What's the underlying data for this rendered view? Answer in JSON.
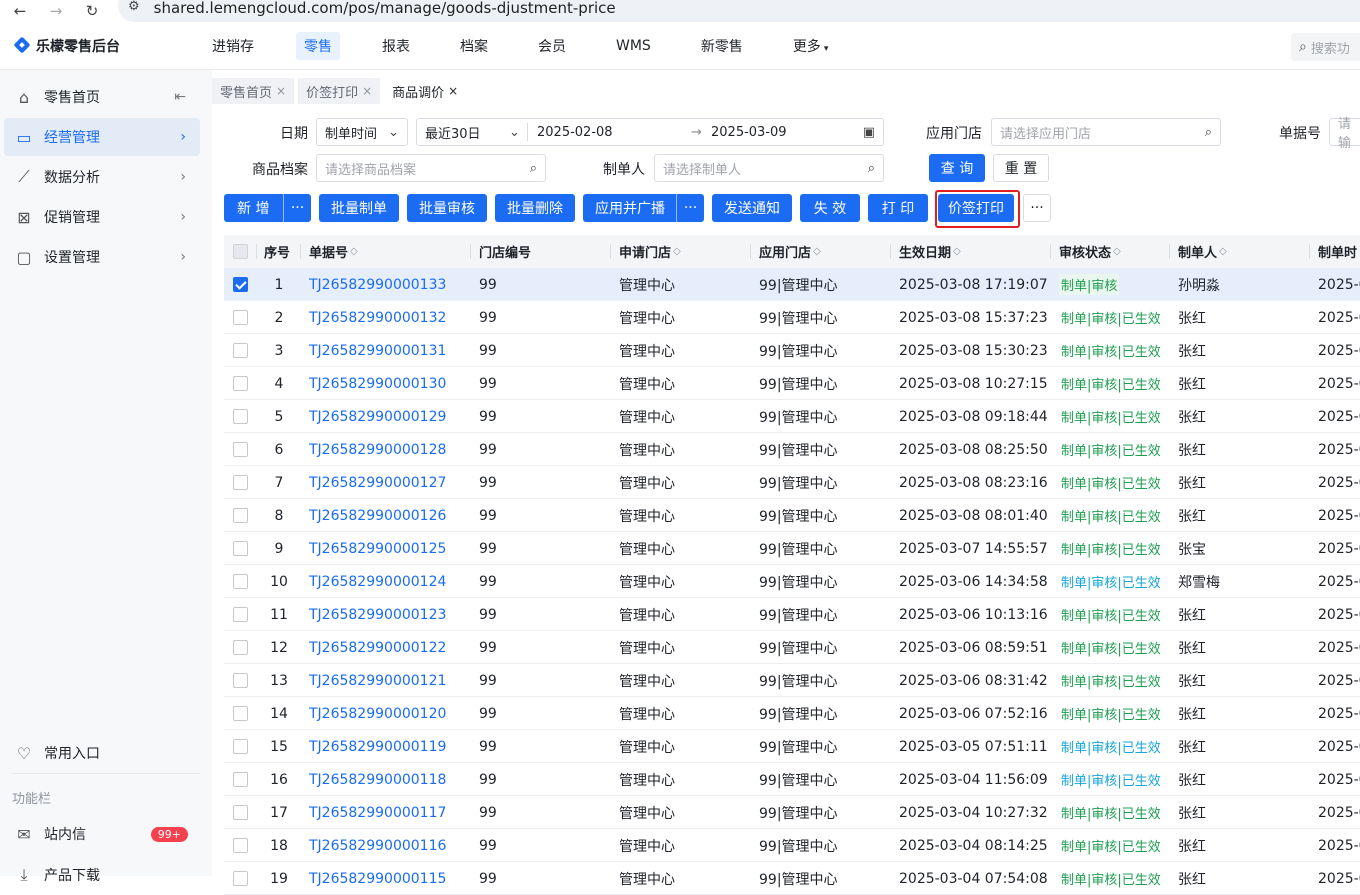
{
  "browser": {
    "url": "shared.lemengcloud.com/pos/manage/goods-djustment-price"
  },
  "app": {
    "title": "乐檬零售后台"
  },
  "topnav": [
    "进销存",
    "零售",
    "报表",
    "档案",
    "会员",
    "WMS",
    "新零售",
    "更多"
  ],
  "topnav_active": "零售",
  "search": {
    "placeholder": "搜索功"
  },
  "sidebar": {
    "items": [
      {
        "label": "零售首页",
        "icon": "home-icon"
      },
      {
        "label": "经营管理",
        "icon": "chart-screen-icon"
      },
      {
        "label": "数据分析",
        "icon": "trend-icon"
      },
      {
        "label": "促销管理",
        "icon": "promo-icon"
      },
      {
        "label": "设置管理",
        "icon": "folder-icon"
      }
    ],
    "favorites": "常用入口",
    "section": "功能栏",
    "messages": "站内信",
    "messages_badge": "99+",
    "download": "产品下载"
  },
  "tabs": [
    {
      "label": "零售首页"
    },
    {
      "label": "价签打印"
    },
    {
      "label": "商品调价"
    }
  ],
  "filters": {
    "date_label": "日期",
    "date_type": "制单时间",
    "date_range": "最近30日",
    "date_start": "2025-02-08",
    "date_end": "2025-03-09",
    "store_label": "应用门店",
    "store_placeholder": "请选择应用门店",
    "doc_label": "单据号",
    "doc_placeholder": "请输",
    "goods_label": "商品档案",
    "goods_placeholder": "请选择商品档案",
    "maker_label": "制单人",
    "maker_placeholder": "请选择制单人",
    "query": "查 询",
    "reset": "重 置"
  },
  "toolbar": {
    "add": "新 增",
    "batch_create": "批量制单",
    "batch_audit": "批量审核",
    "batch_delete": "批量删除",
    "apply_broadcast": "应用并广播",
    "notify": "发送通知",
    "invalidate": "失 效",
    "print": "打 印",
    "price_label_print": "价签打印",
    "more": "···"
  },
  "table": {
    "headers": [
      "序号",
      "单据号",
      "门店编号",
      "申请门店",
      "应用门店",
      "生效日期",
      "审核状态",
      "制单人",
      "制单时"
    ],
    "rows": [
      {
        "no": "1",
        "doc": "TJ26582990000133",
        "store_no": "99",
        "apply": "管理中心",
        "use": "99|管理中心",
        "date": "2025-03-08 17:19:07",
        "status": "制单|审核",
        "maker": "孙明淼",
        "time": "2025-0"
      },
      {
        "no": "2",
        "doc": "TJ26582990000132",
        "store_no": "99",
        "apply": "管理中心",
        "use": "99|管理中心",
        "date": "2025-03-08 15:37:23",
        "status": "制单|审核|已生效",
        "maker": "张红",
        "time": "2025-0"
      },
      {
        "no": "3",
        "doc": "TJ26582990000131",
        "store_no": "99",
        "apply": "管理中心",
        "use": "99|管理中心",
        "date": "2025-03-08 15:30:23",
        "status": "制单|审核|已生效",
        "maker": "张红",
        "time": "2025-0"
      },
      {
        "no": "4",
        "doc": "TJ26582990000130",
        "store_no": "99",
        "apply": "管理中心",
        "use": "99|管理中心",
        "date": "2025-03-08 10:27:15",
        "status": "制单|审核|已生效",
        "maker": "张红",
        "time": "2025-0"
      },
      {
        "no": "5",
        "doc": "TJ26582990000129",
        "store_no": "99",
        "apply": "管理中心",
        "use": "99|管理中心",
        "date": "2025-03-08 09:18:44",
        "status": "制单|审核|已生效",
        "maker": "张红",
        "time": "2025-0"
      },
      {
        "no": "6",
        "doc": "TJ26582990000128",
        "store_no": "99",
        "apply": "管理中心",
        "use": "99|管理中心",
        "date": "2025-03-08 08:25:50",
        "status": "制单|审核|已生效",
        "maker": "张红",
        "time": "2025-0"
      },
      {
        "no": "7",
        "doc": "TJ26582990000127",
        "store_no": "99",
        "apply": "管理中心",
        "use": "99|管理中心",
        "date": "2025-03-08 08:23:16",
        "status": "制单|审核|已生效",
        "maker": "张红",
        "time": "2025-0"
      },
      {
        "no": "8",
        "doc": "TJ26582990000126",
        "store_no": "99",
        "apply": "管理中心",
        "use": "99|管理中心",
        "date": "2025-03-08 08:01:40",
        "status": "制单|审核|已生效",
        "maker": "张红",
        "time": "2025-0"
      },
      {
        "no": "9",
        "doc": "TJ26582990000125",
        "store_no": "99",
        "apply": "管理中心",
        "use": "99|管理中心",
        "date": "2025-03-07 14:55:57",
        "status": "制单|审核|已生效",
        "maker": "张宝",
        "time": "2025-0"
      },
      {
        "no": "10",
        "doc": "TJ26582990000124",
        "store_no": "99",
        "apply": "管理中心",
        "use": "99|管理中心",
        "date": "2025-03-06 14:34:58",
        "status": "制单|审核|已生效",
        "maker": "郑雪梅",
        "time": "2025-0"
      },
      {
        "no": "11",
        "doc": "TJ26582990000123",
        "store_no": "99",
        "apply": "管理中心",
        "use": "99|管理中心",
        "date": "2025-03-06 10:13:16",
        "status": "制单|审核|已生效",
        "maker": "张红",
        "time": "2025-0"
      },
      {
        "no": "12",
        "doc": "TJ26582990000122",
        "store_no": "99",
        "apply": "管理中心",
        "use": "99|管理中心",
        "date": "2025-03-06 08:59:51",
        "status": "制单|审核|已生效",
        "maker": "张红",
        "time": "2025-0"
      },
      {
        "no": "13",
        "doc": "TJ26582990000121",
        "store_no": "99",
        "apply": "管理中心",
        "use": "99|管理中心",
        "date": "2025-03-06 08:31:42",
        "status": "制单|审核|已生效",
        "maker": "张红",
        "time": "2025-0"
      },
      {
        "no": "14",
        "doc": "TJ26582990000120",
        "store_no": "99",
        "apply": "管理中心",
        "use": "99|管理中心",
        "date": "2025-03-06 07:52:16",
        "status": "制单|审核|已生效",
        "maker": "张红",
        "time": "2025-0"
      },
      {
        "no": "15",
        "doc": "TJ26582990000119",
        "store_no": "99",
        "apply": "管理中心",
        "use": "99|管理中心",
        "date": "2025-03-05 07:51:11",
        "status": "制单|审核|已生效",
        "maker": "张红",
        "time": "2025-0"
      },
      {
        "no": "16",
        "doc": "TJ26582990000118",
        "store_no": "99",
        "apply": "管理中心",
        "use": "99|管理中心",
        "date": "2025-03-04 11:56:09",
        "status": "制单|审核|已生效",
        "maker": "张红",
        "time": "2025-0"
      },
      {
        "no": "17",
        "doc": "TJ26582990000117",
        "store_no": "99",
        "apply": "管理中心",
        "use": "99|管理中心",
        "date": "2025-03-04 10:27:32",
        "status": "制单|审核|已生效",
        "maker": "张红",
        "time": "2025-0"
      },
      {
        "no": "18",
        "doc": "TJ26582990000116",
        "store_no": "99",
        "apply": "管理中心",
        "use": "99|管理中心",
        "date": "2025-03-04 08:14:25",
        "status": "制单|审核|已生效",
        "maker": "张红",
        "time": "2025-0"
      },
      {
        "no": "19",
        "doc": "TJ26582990000115",
        "store_no": "99",
        "apply": "管理中心",
        "use": "99|管理中心",
        "date": "2025-03-04 07:54:08",
        "status": "制单|审核|已生效",
        "maker": "张红",
        "time": "2025-0"
      }
    ],
    "selected_row": "1",
    "status_colors": {
      "green": "#1e9e52",
      "cyan": "#16a6d8"
    }
  },
  "colors": {
    "accent": "#1b6cf2",
    "highlight_box": "#e02020",
    "badge": "#f5414d"
  }
}
